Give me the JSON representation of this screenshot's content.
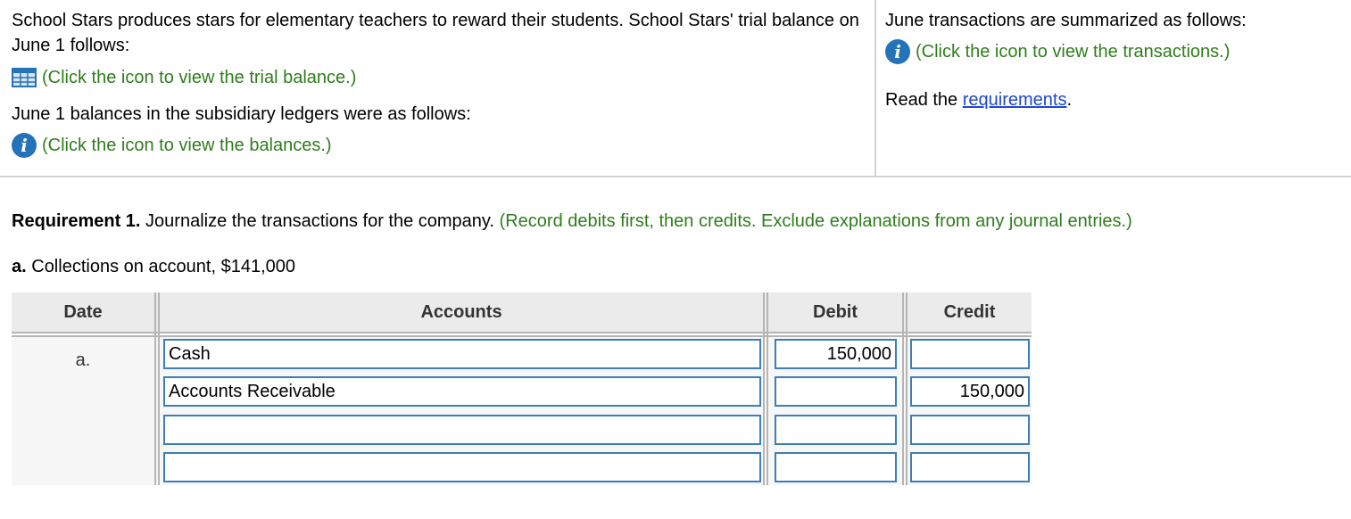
{
  "intro": {
    "paragraph": "School Stars produces stars for elementary teachers to reward their students. School Stars' trial balance on June 1 follows:",
    "trial_balance_link": "(Click the icon to view the trial balance.)",
    "subsidiary_text": "June 1 balances in the subsidiary ledgers were as follows:",
    "balances_link": "(Click the icon to view the balances.)"
  },
  "side": {
    "transactions_text": "June transactions are summarized as follows:",
    "transactions_link": "(Click the icon to view the transactions.)",
    "read_prefix": "Read the ",
    "requirements_link": "requirements",
    "read_suffix": "."
  },
  "requirement": {
    "label": "Requirement 1.",
    "text": " Journalize the transactions for the company.",
    "instruction": " (Record debits first, then credits. Exclude explanations from any journal entries.)"
  },
  "part": {
    "label": "a.",
    "text": " Collections on account, $141,000"
  },
  "journal": {
    "headers": {
      "date": "Date",
      "accounts": "Accounts",
      "debit": "Debit",
      "credit": "Credit"
    },
    "date_label": "a.",
    "rows": [
      {
        "account": "Cash",
        "debit": "150,000",
        "credit": ""
      },
      {
        "account": "Accounts Receivable",
        "debit": "",
        "credit": "150,000"
      },
      {
        "account": "",
        "debit": "",
        "credit": ""
      },
      {
        "account": "",
        "debit": "",
        "credit": ""
      }
    ]
  },
  "icons": {
    "info": "info-icon",
    "grid": "table-grid-icon"
  },
  "colors": {
    "instruction_green": "#2e7d1b",
    "link_blue": "#1d47d1",
    "info_icon_blue": "#2472b8",
    "input_border": "#3b7fb6",
    "header_bg": "#ebebeb"
  }
}
